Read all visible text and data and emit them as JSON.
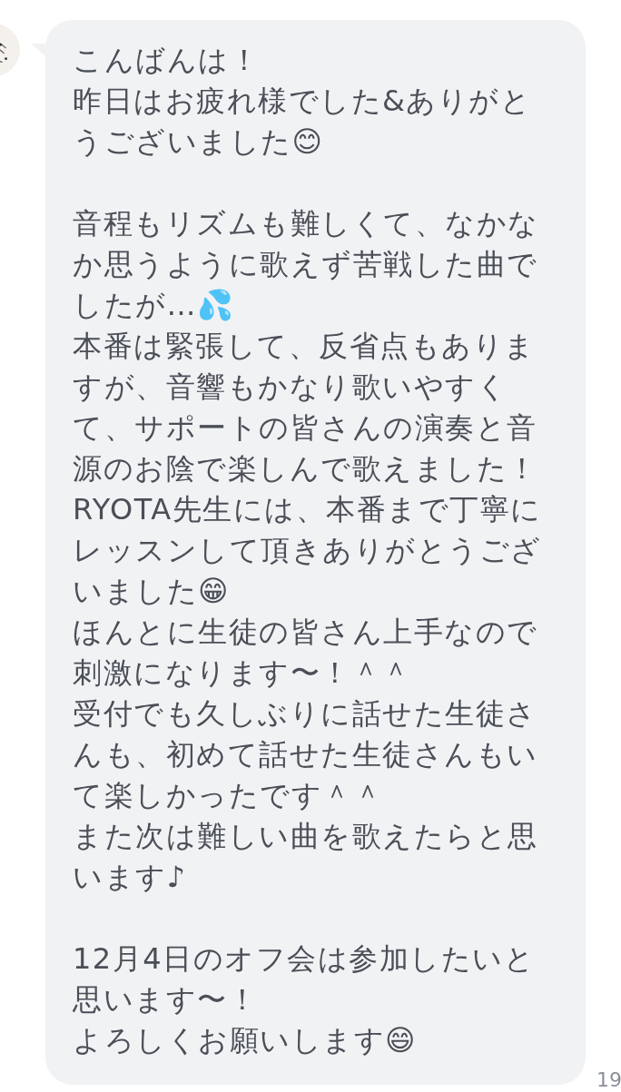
{
  "message": {
    "paragraphs": [
      [
        "こんばんは！",
        "昨日はお疲れ様でした&ありがとうございました😊"
      ],
      [
        "音程もリズムも難しくて、なかなか思うように歌えず苦戦した曲でしたが…💦",
        "本番は緊張して、反省点もありますが、音響もかなり歌いやすくて、サポートの皆さんの演奏と音源のお陰で楽しんで歌えました！",
        "RYOTA先生には、本番まで丁寧にレッスンして頂きありがとうございました😁",
        "ほんとに生徒の皆さん上手なので刺激になります〜！＾＾",
        "受付でも久しぶりに話せた生徒さんも、初めて話せた生徒さんもいて楽しかったです＾＾",
        "また次は難しい曲を歌えたらと思います♪"
      ],
      [
        "12月4日のオフ会は参加したいと思います〜！",
        "よろしくお願いします😄"
      ]
    ],
    "time": "19"
  }
}
